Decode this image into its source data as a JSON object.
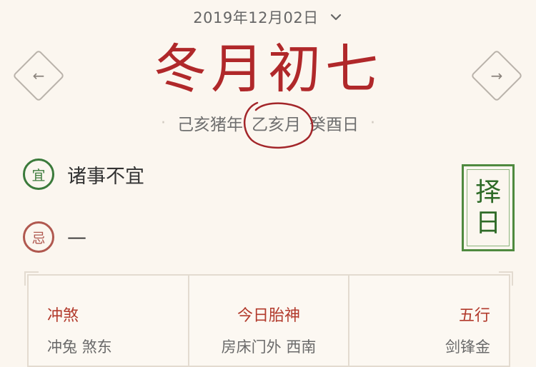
{
  "header": {
    "date": "2019年12月02日"
  },
  "navigation": {
    "prev_symbol": "←",
    "next_symbol": "→"
  },
  "lunar": {
    "title": "冬月初七",
    "year_ganzhi": "己亥猪年",
    "month_ganzhi": "乙亥月",
    "day_ganzhi": "癸酉日"
  },
  "yi": {
    "badge": "宜",
    "text": "诸事不宜"
  },
  "ji": {
    "badge": "忌",
    "text": "—"
  },
  "zeri_button": {
    "char_1": "择",
    "char_2": "日"
  },
  "info": [
    {
      "label": "冲煞",
      "value": "冲兔 煞东"
    },
    {
      "label": "今日胎神",
      "value": "房床门外 西南"
    },
    {
      "label": "五行",
      "value": "剑锋金"
    }
  ],
  "colors": {
    "accent_red": "#b0282a",
    "yi_green": "#3b7a3b",
    "ji_red": "#b0584f",
    "background": "#fbf6ef"
  }
}
